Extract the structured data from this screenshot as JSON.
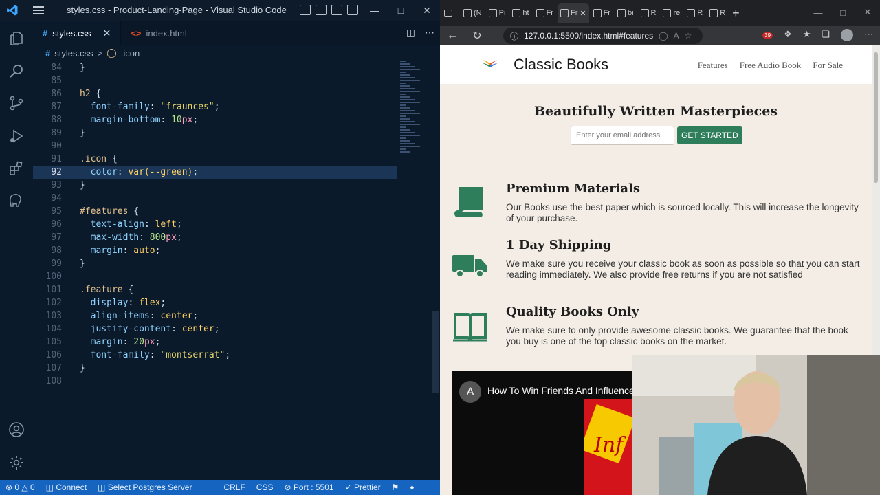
{
  "vscode": {
    "title": "styles.css - Product-Landing-Page - Visual Studio Code",
    "tabs": [
      {
        "label": "styles.css",
        "active": true
      },
      {
        "label": "index.html",
        "active": false
      }
    ],
    "breadcrumb": {
      "file": "styles.css",
      "sep": ">",
      "symbol": ".icon"
    },
    "code_lines": [
      {
        "n": "84",
        "code": "}"
      },
      {
        "n": "85",
        "code": ""
      },
      {
        "n": "86",
        "code": "h2 {"
      },
      {
        "n": "87",
        "code": "  font-family: \"fraunces\";"
      },
      {
        "n": "88",
        "code": "  margin-bottom: 10px;"
      },
      {
        "n": "89",
        "code": "}"
      },
      {
        "n": "90",
        "code": ""
      },
      {
        "n": "91",
        "code": ".icon {"
      },
      {
        "n": "92",
        "code": "  color: var(--green);"
      },
      {
        "n": "93",
        "code": "}"
      },
      {
        "n": "94",
        "code": ""
      },
      {
        "n": "95",
        "code": "#features {"
      },
      {
        "n": "96",
        "code": "  text-align: left;"
      },
      {
        "n": "97",
        "code": "  max-width: 800px;"
      },
      {
        "n": "98",
        "code": "  margin: auto;"
      },
      {
        "n": "99",
        "code": "}"
      },
      {
        "n": "100",
        "code": ""
      },
      {
        "n": "101",
        "code": ".feature {"
      },
      {
        "n": "102",
        "code": "  display: flex;"
      },
      {
        "n": "103",
        "code": "  align-items: center;"
      },
      {
        "n": "104",
        "code": "  justify-content: center;"
      },
      {
        "n": "105",
        "code": "  margin: 20px;"
      },
      {
        "n": "106",
        "code": "  font-family: \"montserrat\";"
      },
      {
        "n": "107",
        "code": "}"
      },
      {
        "n": "108",
        "code": ""
      }
    ],
    "current_line": "92",
    "status": {
      "errors": "0",
      "warnings": "0",
      "connect": "Connect",
      "postgres": "Select Postgres Server",
      "eol": "CRLF",
      "language": "CSS",
      "port": "Port : 5501",
      "prettier": "Prettier"
    }
  },
  "browser": {
    "tabs": [
      "(N",
      "Pi",
      "ht",
      "Fr",
      "Fr",
      "Fr",
      "bi",
      "R",
      "re",
      "R",
      "R"
    ],
    "active_tab_index": 4,
    "url": "127.0.0.1:5500/index.html#features",
    "notification_count": "39",
    "site": {
      "brand": "Classic Books",
      "nav": [
        "Features",
        "Free Audio Book",
        "For Sale"
      ],
      "hero_title": "Beautifully Written Masterpieces",
      "email_placeholder": "Enter your email address",
      "cta": "GET STARTED",
      "features": [
        {
          "icon": "scroll-icon",
          "title": "Premium Materials",
          "text": "Our Books use the best paper which is sourced locally. This will increase the longevity of your purchase."
        },
        {
          "icon": "truck-icon",
          "title": "1 Day Shipping",
          "text": "We make sure you receive your classic book as soon as possible so that you can start reading immediately. We also provide free returns if you are not satisfied"
        },
        {
          "icon": "book-open-icon",
          "title": "Quality Books Only",
          "text": "We make sure to only provide awesome classic books. We guarantee that the book you buy is one of the top classic books on the market."
        }
      ],
      "video": {
        "avatar_letter": "A",
        "title": "How To Win Friends And Influence People",
        "cover_text": "Inf"
      }
    }
  },
  "colors": {
    "accent_green": "#2e7d5b",
    "status_blue": "#1565c0",
    "editor_bg": "#0b1a2b"
  }
}
